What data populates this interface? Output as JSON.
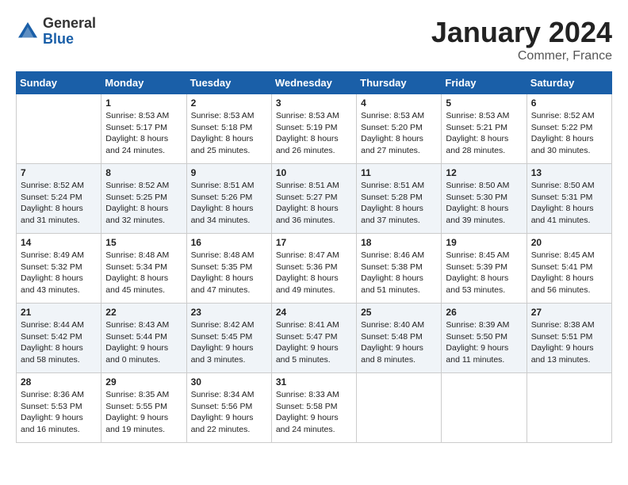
{
  "header": {
    "logo_general": "General",
    "logo_blue": "Blue",
    "month_year": "January 2024",
    "location": "Commer, France"
  },
  "days_of_week": [
    "Sunday",
    "Monday",
    "Tuesday",
    "Wednesday",
    "Thursday",
    "Friday",
    "Saturday"
  ],
  "weeks": [
    [
      {
        "day": "",
        "content": ""
      },
      {
        "day": "1",
        "content": "Sunrise: 8:53 AM\nSunset: 5:17 PM\nDaylight: 8 hours\nand 24 minutes."
      },
      {
        "day": "2",
        "content": "Sunrise: 8:53 AM\nSunset: 5:18 PM\nDaylight: 8 hours\nand 25 minutes."
      },
      {
        "day": "3",
        "content": "Sunrise: 8:53 AM\nSunset: 5:19 PM\nDaylight: 8 hours\nand 26 minutes."
      },
      {
        "day": "4",
        "content": "Sunrise: 8:53 AM\nSunset: 5:20 PM\nDaylight: 8 hours\nand 27 minutes."
      },
      {
        "day": "5",
        "content": "Sunrise: 8:53 AM\nSunset: 5:21 PM\nDaylight: 8 hours\nand 28 minutes."
      },
      {
        "day": "6",
        "content": "Sunrise: 8:52 AM\nSunset: 5:22 PM\nDaylight: 8 hours\nand 30 minutes."
      }
    ],
    [
      {
        "day": "7",
        "content": "Sunrise: 8:52 AM\nSunset: 5:24 PM\nDaylight: 8 hours\nand 31 minutes."
      },
      {
        "day": "8",
        "content": "Sunrise: 8:52 AM\nSunset: 5:25 PM\nDaylight: 8 hours\nand 32 minutes."
      },
      {
        "day": "9",
        "content": "Sunrise: 8:51 AM\nSunset: 5:26 PM\nDaylight: 8 hours\nand 34 minutes."
      },
      {
        "day": "10",
        "content": "Sunrise: 8:51 AM\nSunset: 5:27 PM\nDaylight: 8 hours\nand 36 minutes."
      },
      {
        "day": "11",
        "content": "Sunrise: 8:51 AM\nSunset: 5:28 PM\nDaylight: 8 hours\nand 37 minutes."
      },
      {
        "day": "12",
        "content": "Sunrise: 8:50 AM\nSunset: 5:30 PM\nDaylight: 8 hours\nand 39 minutes."
      },
      {
        "day": "13",
        "content": "Sunrise: 8:50 AM\nSunset: 5:31 PM\nDaylight: 8 hours\nand 41 minutes."
      }
    ],
    [
      {
        "day": "14",
        "content": "Sunrise: 8:49 AM\nSunset: 5:32 PM\nDaylight: 8 hours\nand 43 minutes."
      },
      {
        "day": "15",
        "content": "Sunrise: 8:48 AM\nSunset: 5:34 PM\nDaylight: 8 hours\nand 45 minutes."
      },
      {
        "day": "16",
        "content": "Sunrise: 8:48 AM\nSunset: 5:35 PM\nDaylight: 8 hours\nand 47 minutes."
      },
      {
        "day": "17",
        "content": "Sunrise: 8:47 AM\nSunset: 5:36 PM\nDaylight: 8 hours\nand 49 minutes."
      },
      {
        "day": "18",
        "content": "Sunrise: 8:46 AM\nSunset: 5:38 PM\nDaylight: 8 hours\nand 51 minutes."
      },
      {
        "day": "19",
        "content": "Sunrise: 8:45 AM\nSunset: 5:39 PM\nDaylight: 8 hours\nand 53 minutes."
      },
      {
        "day": "20",
        "content": "Sunrise: 8:45 AM\nSunset: 5:41 PM\nDaylight: 8 hours\nand 56 minutes."
      }
    ],
    [
      {
        "day": "21",
        "content": "Sunrise: 8:44 AM\nSunset: 5:42 PM\nDaylight: 8 hours\nand 58 minutes."
      },
      {
        "day": "22",
        "content": "Sunrise: 8:43 AM\nSunset: 5:44 PM\nDaylight: 9 hours\nand 0 minutes."
      },
      {
        "day": "23",
        "content": "Sunrise: 8:42 AM\nSunset: 5:45 PM\nDaylight: 9 hours\nand 3 minutes."
      },
      {
        "day": "24",
        "content": "Sunrise: 8:41 AM\nSunset: 5:47 PM\nDaylight: 9 hours\nand 5 minutes."
      },
      {
        "day": "25",
        "content": "Sunrise: 8:40 AM\nSunset: 5:48 PM\nDaylight: 9 hours\nand 8 minutes."
      },
      {
        "day": "26",
        "content": "Sunrise: 8:39 AM\nSunset: 5:50 PM\nDaylight: 9 hours\nand 11 minutes."
      },
      {
        "day": "27",
        "content": "Sunrise: 8:38 AM\nSunset: 5:51 PM\nDaylight: 9 hours\nand 13 minutes."
      }
    ],
    [
      {
        "day": "28",
        "content": "Sunrise: 8:36 AM\nSunset: 5:53 PM\nDaylight: 9 hours\nand 16 minutes."
      },
      {
        "day": "29",
        "content": "Sunrise: 8:35 AM\nSunset: 5:55 PM\nDaylight: 9 hours\nand 19 minutes."
      },
      {
        "day": "30",
        "content": "Sunrise: 8:34 AM\nSunset: 5:56 PM\nDaylight: 9 hours\nand 22 minutes."
      },
      {
        "day": "31",
        "content": "Sunrise: 8:33 AM\nSunset: 5:58 PM\nDaylight: 9 hours\nand 24 minutes."
      },
      {
        "day": "",
        "content": ""
      },
      {
        "day": "",
        "content": ""
      },
      {
        "day": "",
        "content": ""
      }
    ]
  ]
}
